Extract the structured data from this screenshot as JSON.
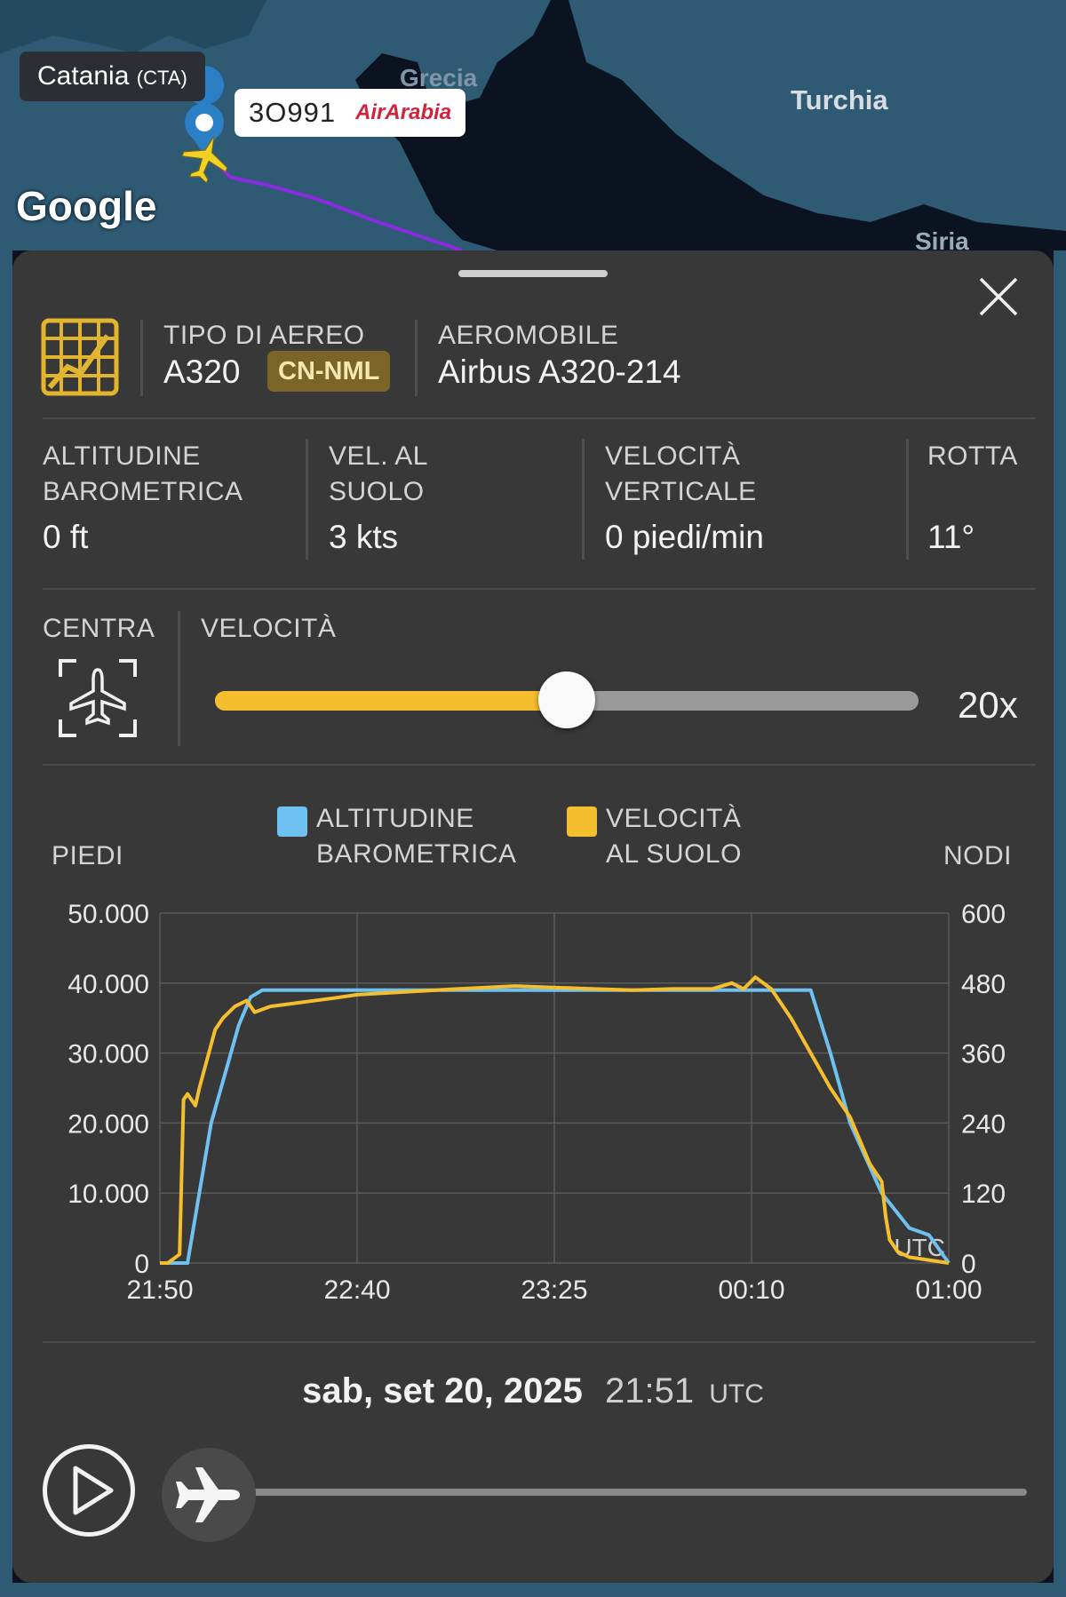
{
  "map": {
    "city_name": "Catania",
    "city_code": "(CTA)",
    "flight_number": "3O991",
    "airline": "AirArabia",
    "labels": [
      "Grecia",
      "Turchia",
      "Siria"
    ],
    "attribution": "Google",
    "colors": {
      "sea": "#0b1220",
      "land": "#2e5a74",
      "route": "#8a2be2",
      "plane": "#f4d024"
    }
  },
  "panel": {
    "aircraft_type_label": "TIPO DI AEREO",
    "aircraft_type": "A320",
    "registration": "CN-NML",
    "aircraft_label": "AEROMOBILE",
    "aircraft_model": "Airbus A320-214",
    "stats": [
      {
        "label_1": "ALTITUDINE",
        "label_2": "BAROMETRICA",
        "value": "0 ft"
      },
      {
        "label_1": "VEL. AL",
        "label_2": "SUOLO",
        "value": "3 kts"
      },
      {
        "label_1": "VELOCITÀ",
        "label_2": "VERTICALE",
        "value": "0 piedi/min"
      },
      {
        "label_1": "ROTTA",
        "label_2": "",
        "value": "11°"
      }
    ],
    "center_label": "CENTRA",
    "speed_label": "VELOCITÀ",
    "speed_value": "20x",
    "speed_fraction": 0.5,
    "date": "sab, set 20, 2025",
    "time": "21:51",
    "time_zone": "UTC",
    "playback_fraction": 0.0,
    "icons": [
      "chart-grid-icon",
      "close-icon",
      "center-plane-icon",
      "play-icon",
      "plane-icon"
    ]
  },
  "chart_data": {
    "type": "line",
    "left_axis_label": "PIEDI",
    "right_axis_label": "NODI",
    "utc_note": "UTC",
    "x_ticks": [
      "21:50",
      "22:40",
      "23:25",
      "00:10",
      "01:00"
    ],
    "y_ticks_left": [
      "0",
      "10.000",
      "20.000",
      "30.000",
      "40.000",
      "50.000"
    ],
    "y_ticks_right": [
      "0",
      "120",
      "240",
      "360",
      "480",
      "600"
    ],
    "ylim_left": [
      0,
      50000
    ],
    "ylim_right": [
      0,
      600
    ],
    "xlim_minutes": [
      0,
      200
    ],
    "grid": true,
    "series": [
      {
        "name_1": "ALTITUDINE",
        "name_2": "BAROMETRICA",
        "color": "#6ec1f0",
        "axis": "left",
        "x": [
          0,
          5,
          7,
          10,
          13,
          17,
          20,
          23,
          26,
          140,
          165,
          170,
          175,
          183,
          190,
          195,
          200
        ],
        "y": [
          0,
          0,
          0,
          10000,
          20000,
          28000,
          34000,
          38000,
          39000,
          39000,
          39000,
          30000,
          20000,
          10000,
          5000,
          4000,
          0
        ]
      },
      {
        "name_1": "VELOCITÀ",
        "name_2": "AL SUOLO",
        "color": "#f4be2e",
        "axis": "right",
        "x": [
          0,
          2,
          5,
          6,
          7,
          9,
          10,
          14,
          16,
          19,
          22,
          24,
          28,
          45,
          50,
          70,
          90,
          110,
          120,
          130,
          140,
          145,
          148,
          151,
          155,
          160,
          165,
          170,
          175,
          180,
          183,
          184,
          185,
          187,
          190,
          200
        ],
        "y": [
          0,
          0,
          15,
          280,
          290,
          270,
          300,
          400,
          420,
          440,
          450,
          430,
          440,
          455,
          460,
          468,
          475,
          470,
          468,
          470,
          470,
          480,
          470,
          490,
          470,
          420,
          360,
          300,
          250,
          170,
          140,
          80,
          40,
          20,
          10,
          0
        ]
      }
    ]
  }
}
